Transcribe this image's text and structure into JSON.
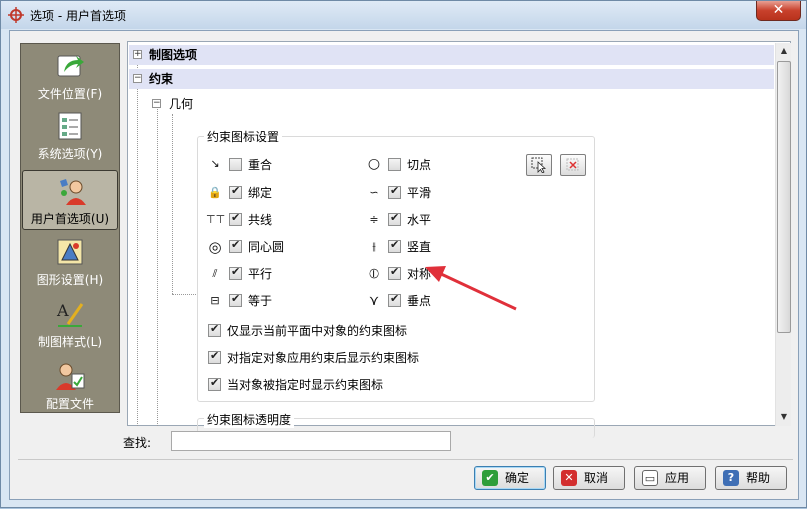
{
  "window": {
    "title": "选项 - 用户首选项",
    "close_label": "✕"
  },
  "nav": {
    "items": [
      {
        "label": "文件位置(F)",
        "icon": "folder-arrow-icon"
      },
      {
        "label": "系统选项(Y)",
        "icon": "checklist-icon"
      },
      {
        "label": "用户首选项(U)",
        "icon": "user-preferences-icon",
        "selected": true
      },
      {
        "label": "图形设置(H)",
        "icon": "graphics-settings-icon"
      },
      {
        "label": "制图样式(L)",
        "icon": "drafting-style-icon"
      },
      {
        "label": "配置文件",
        "icon": "profile-icon"
      }
    ]
  },
  "tree": {
    "drafting_options": "制图选项",
    "constraints": "约束",
    "geometry": "几何",
    "group_title": "约束图标设置",
    "transparency_title": "约束图标透明度"
  },
  "constraints": {
    "left": [
      {
        "label": "重合",
        "checked": false,
        "symbol": "↘"
      },
      {
        "label": "绑定",
        "checked": true,
        "symbol": "🔒"
      },
      {
        "label": "共线",
        "checked": true,
        "symbol": "⊤⊤"
      },
      {
        "label": "同心圆",
        "checked": true,
        "symbol": "◎"
      },
      {
        "label": "平行",
        "checked": true,
        "symbol": "⫽"
      },
      {
        "label": "等于",
        "checked": true,
        "symbol": "⊟"
      }
    ],
    "right": [
      {
        "label": "切点",
        "checked": false,
        "symbol": "○"
      },
      {
        "label": "平滑",
        "checked": true,
        "symbol": "∽"
      },
      {
        "label": "水平",
        "checked": true,
        "symbol": "≑"
      },
      {
        "label": "竖直",
        "checked": true,
        "symbol": "⫲"
      },
      {
        "label": "对称",
        "checked": true,
        "symbol": "⦶"
      },
      {
        "label": "垂点",
        "checked": true,
        "symbol": "⋎"
      }
    ]
  },
  "options": [
    {
      "label": "仅显示当前平面中对象的约束图标",
      "checked": true
    },
    {
      "label": "对指定对象应用约束后显示约束图标",
      "checked": true
    },
    {
      "label": "当对象被指定时显示约束图标",
      "checked": true
    }
  ],
  "find": {
    "label": "查找:",
    "value": ""
  },
  "buttons": {
    "ok": "确定",
    "cancel": "取消",
    "apply": "应用",
    "help": "帮助"
  },
  "colors": {
    "highlight_row": "#e0e3f5",
    "nav_background": "#8e8a78",
    "annotation_arrow": "#e0303a"
  }
}
